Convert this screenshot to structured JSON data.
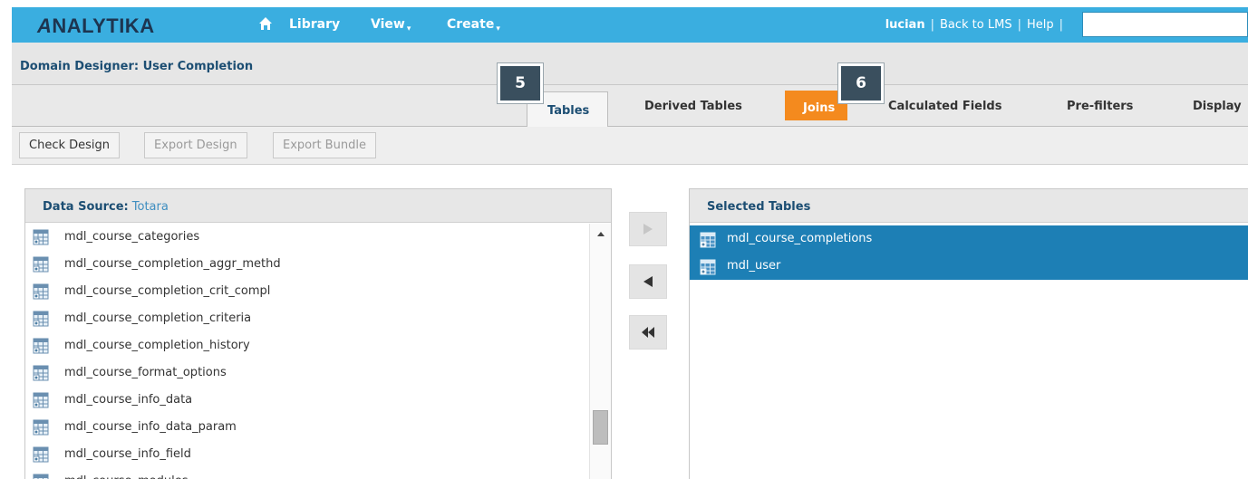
{
  "app": {
    "logo": "ANALYTIKA",
    "nav": [
      {
        "label": "Library",
        "dropdown": false
      },
      {
        "label": "View",
        "dropdown": true
      },
      {
        "label": "Create",
        "dropdown": true
      }
    ],
    "user": "lucian",
    "back_link": "Back to LMS",
    "help_link": "Help",
    "separator": "|",
    "search_value": ""
  },
  "title": "Domain Designer: User Completion",
  "tabs": [
    {
      "label": "Tables",
      "state": "active"
    },
    {
      "label": "Derived Tables",
      "state": "normal"
    },
    {
      "label": "Joins",
      "state": "highlighted"
    },
    {
      "label": "Calculated Fields",
      "state": "normal"
    },
    {
      "label": "Pre-filters",
      "state": "normal"
    },
    {
      "label": "Display",
      "state": "normal"
    }
  ],
  "markers": [
    "5",
    "6"
  ],
  "toolbar": {
    "check_design": "Check Design",
    "export_design": "Export Design",
    "export_bundle": "Export Bundle"
  },
  "data_source": {
    "label": "Data Source:",
    "name": "Totara",
    "tables": [
      "mdl_course_categories",
      "mdl_course_completion_aggr_methd",
      "mdl_course_completion_crit_compl",
      "mdl_course_completion_criteria",
      "mdl_course_completion_history",
      "mdl_course_format_options",
      "mdl_course_info_data",
      "mdl_course_info_data_param",
      "mdl_course_info_field",
      "mdl_course_modules"
    ]
  },
  "selected": {
    "label": "Selected Tables",
    "tables": [
      "mdl_course_completions",
      "mdl_user"
    ]
  },
  "icons": {
    "home": "home-icon",
    "table": "table-icon",
    "move_right": "arrow-right-icon",
    "move_left": "arrow-left-icon",
    "move_all_left": "double-arrow-left-icon"
  },
  "colors": {
    "topbar": "#3aaee0",
    "logo": "#1d3550",
    "joins_tab": "#f48a1e",
    "selection": "#1d7fb5",
    "marker": "#3a4f5e"
  }
}
